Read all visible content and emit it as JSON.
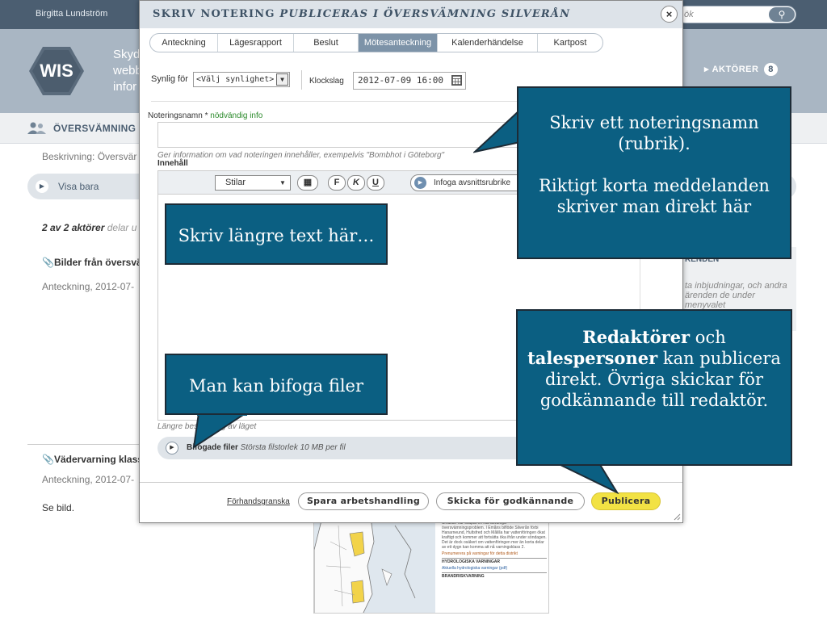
{
  "topbar": {
    "user": "Birgitta Lundström",
    "search_placeholder": "ök",
    "search_icon": "magnifier-icon"
  },
  "header": {
    "logo": "WIS",
    "tagline_lines": [
      "Skyd",
      "webb",
      "infor"
    ],
    "actors_label": "AKTÖRER",
    "actors_count": "8"
  },
  "crumb": {
    "title": "ÖVERSVÄMNING"
  },
  "background": {
    "beskrivning": "Beskrivning: Översvär",
    "visa_bara": "Visa bara",
    "aktorer_line_bold": "2 av 2 aktörer",
    "aktorer_line_rest": " delar u",
    "item1_title": "Bilder från översvä",
    "item1_meta": "Anteckning,  2012-07-",
    "item2_title": "Vädervarning klass",
    "item2_meta": "Anteckning,  2012-07-",
    "item2_body": "Se bild.",
    "right_head": "RENDEN",
    "right_body": "ta inbjudningar, och andra ärenden de under menyvalet"
  },
  "dialog": {
    "title_normal": "SKRIV NOTERING ",
    "title_italic": "PUBLICERAS I ÖVERSVÄMNING SILVERÅN",
    "close": "×",
    "tabs": [
      {
        "label": "Anteckning",
        "active": false
      },
      {
        "label": "Lägesrapport",
        "active": false
      },
      {
        "label": "Beslut",
        "active": false
      },
      {
        "label": "Mötesanteckning",
        "active": true
      },
      {
        "label": "Kalenderhändelse",
        "active": false
      },
      {
        "label": "Kartpost",
        "active": false
      }
    ],
    "synlig_label": "Synlig för",
    "synlig_value": "<Välj synlighet>",
    "klockslag_label": "Klockslag",
    "klockslag_value": "2012-07-09 16:00",
    "noteringsnamn_label": "Noteringsnamn * ",
    "noteringsnamn_req": "nödvändig info",
    "noteringsnamn_value": "",
    "hint": "Ger information om vad noteringen innehåller, exempelvis \"Bombhot i Göteborg\"",
    "innehall_label": "Innehåll",
    "toolbar": {
      "stilar": "Stilar",
      "table_icon": "table-icon",
      "bold": "F",
      "italic": "K",
      "underline": "U",
      "insert": "Infoga avsnittsrubrike"
    },
    "editor_hint": "Längre beskrivning av läget",
    "attach_label": "Bifogade filer",
    "attach_hint": " Största filstorlek 10 MB per fil",
    "footer": {
      "preview": "Förhandsgranska",
      "save": "Spara arbetshandling",
      "send": "Skicka för godkännande",
      "publish": "Publicera"
    }
  },
  "callouts": {
    "c1_line1": "Skriv ett noteringsnamn (rubrik).",
    "c1_line2": "Riktigt korta meddelanden skriver man direkt här",
    "c2": "Skriv längre text här…",
    "c3": "Man kan bifoga filer",
    "c4_b1": "Redaktörer",
    "c4_t1": " och ",
    "c4_b2": "talespersoner",
    "c4_t2": " kan publicera direkt. Övriga skickar för godkännande till redaktör."
  },
  "map_thumb": {
    "text1": "Smältan har skapat en rad allvarliga översvämningsproblem. I Emåns biflöde Silverån förbi Hanarneund, Hultsfred och Målilla har vattenföringen ökat kraftigt och kommer att fortsätta öka ifrån under söndagen. Det är dock osäkert om vattenföringen mer än korta delar av ett dygn kan komma att nå varningsklass 2.",
    "link1": "Prenumerera på varningar för detta distrikt",
    "head1": "HYDROLOGISKA VARNINGAR",
    "link2": "Aktuella hydrologiska varningar (pdf)",
    "head2": "BRANDRISKVARNING"
  },
  "colors": {
    "dialog_header": "#dde3e9",
    "active_tab": "#7d93a8",
    "callout": "#0b5f82",
    "publish": "#f2e244",
    "topbar": "#4b5e71"
  }
}
